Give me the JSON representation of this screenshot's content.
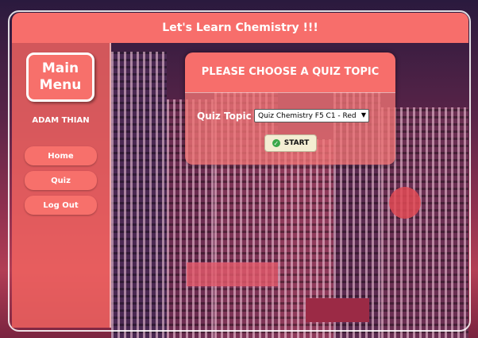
{
  "header": {
    "title": "Let's Learn Chemistry !!!"
  },
  "sidebar": {
    "menu_title_line1": "Main",
    "menu_title_line2": "Menu",
    "username": "ADAM THIAN",
    "items": [
      {
        "label": "Home"
      },
      {
        "label": "Quiz"
      },
      {
        "label": "Log Out"
      }
    ]
  },
  "quiz_card": {
    "heading": "PLEASE CHOOSE A QUIZ TOPIC",
    "topic_label": "Quiz Topic",
    "selected_topic": "Quiz Chemistry F5 C1 - Red",
    "start_label": "START"
  },
  "colors": {
    "accent": "#f76e6b",
    "start_icon": "#3aa84a"
  }
}
